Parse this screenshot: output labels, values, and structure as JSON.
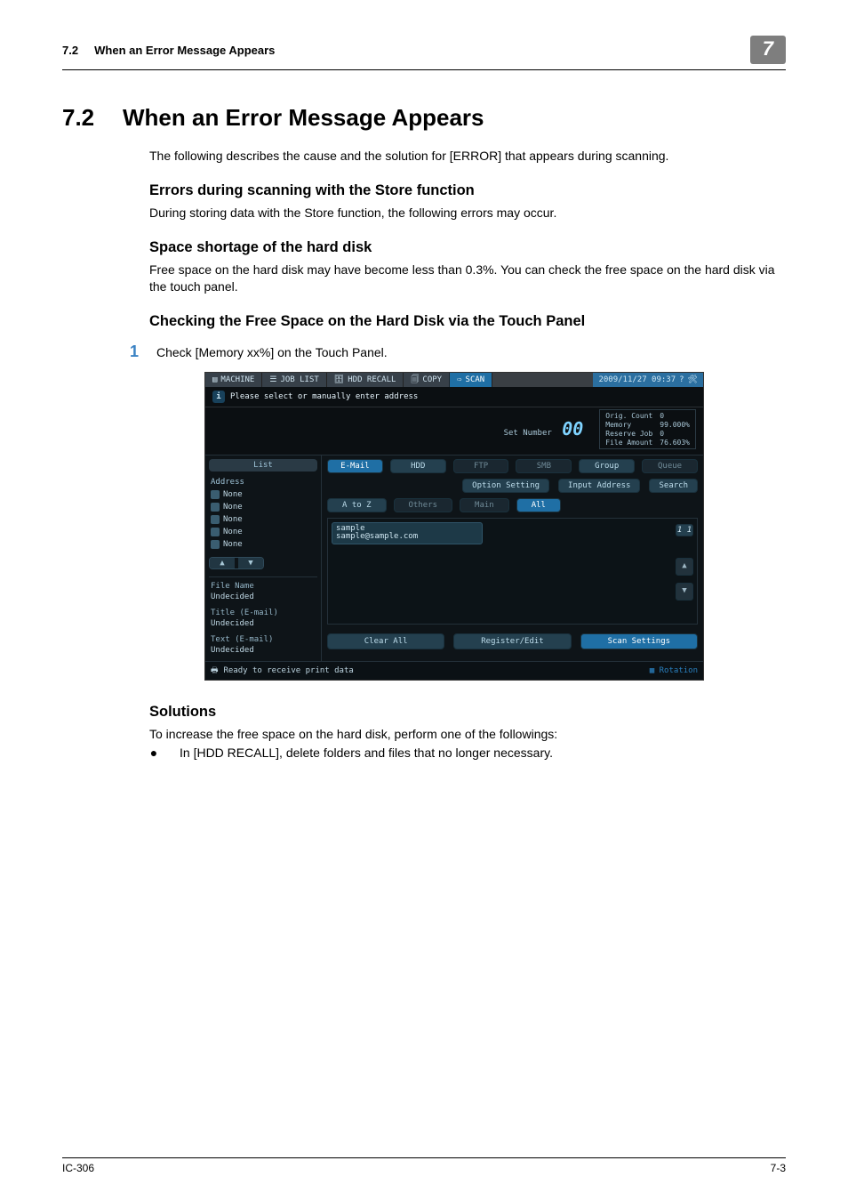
{
  "header": {
    "breadcrumb_num": "7.2",
    "breadcrumb_title": "When an Error Message Appears",
    "chapter": "7"
  },
  "section": {
    "number": "7.2",
    "title": "When an Error Message Appears",
    "lead": "The following describes the cause and the solution for [ERROR] that appears during scanning."
  },
  "sub1": {
    "title": "Errors during scanning with the Store function",
    "body": "During storing data with the Store function, the following errors may occur."
  },
  "sub2": {
    "title": "Space shortage of the hard disk",
    "body": "Free space on the hard disk may have become less than 0.3%.   You can check the free space on the hard disk via the touch panel."
  },
  "sub3": {
    "title": "Checking the Free Space on the Hard Disk via the Touch Panel"
  },
  "step": {
    "num": "1",
    "text": "Check [Memory xx%] on the Touch Panel."
  },
  "tp": {
    "tabs": {
      "machine": "MACHINE",
      "joblist": "JOB LIST",
      "hddrecall": "HDD RECALL",
      "copy": "COPY",
      "scan": "SCAN"
    },
    "clock": "2009/11/27 09:37",
    "msg": "Please select or manually enter address",
    "setnum_label": "Set Number",
    "setnum_value": "00",
    "counters": {
      "orig_label": "Orig. Count",
      "orig_val": "0",
      "reserve_label": "Reserve Job",
      "reserve_val": "0",
      "memory_label": "Memory",
      "memory_val": "99.000%",
      "file_label": "File Amount",
      "file_val": "76.603%"
    },
    "side": {
      "list_label": "List",
      "address_label": "Address",
      "rows": [
        "None",
        "None",
        "None",
        "None",
        "None"
      ],
      "filename_label": "File Name",
      "filename_val": "Undecided",
      "title_label": "Title (E-mail)",
      "title_val": "Undecided",
      "text_label": "Text (E-mail)",
      "text_val": "Undecided"
    },
    "main": {
      "tabs": [
        "E-Mail",
        "HDD",
        "FTP",
        "SMB",
        "Group",
        "Queue"
      ],
      "subtabs": [
        "Option Setting",
        "Input Address",
        "Search"
      ],
      "filter": [
        "A to Z",
        "Others",
        "Main",
        "All"
      ],
      "entry_name": "sample",
      "entry_addr": "sample@sample.com",
      "counter": "1\n1",
      "bottom": [
        "Clear All",
        "Register/Edit",
        "Scan Settings"
      ]
    },
    "status": "Ready to receive print data",
    "rotation": "Rotation"
  },
  "solutions": {
    "title": "Solutions",
    "intro": "To increase the free space on the hard disk, perform one of the followings:",
    "bullet1": "In [HDD RECALL], delete folders and files that no longer necessary."
  },
  "footer": {
    "left": "IC-306",
    "right": "7-3"
  }
}
